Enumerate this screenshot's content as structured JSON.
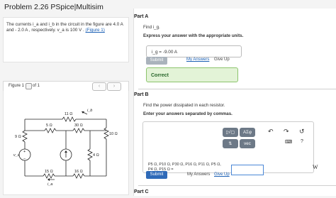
{
  "app": {
    "title": "Problem 2.26 PSpice|Multisim"
  },
  "problem": {
    "text": "The currents i_a and i_b in the circuit in the figure are 4.0 A and - 2.0 A , respectively. v_a is 100 V .",
    "figure_link": "(Figure 1)"
  },
  "figure": {
    "label": "Figure 1",
    "index": "1",
    "of_label": "of 1",
    "prev_icon": "chevron-left-icon",
    "next_icon": "chevron-right-icon",
    "circuit": {
      "r_top": "11 Ω",
      "r_9": "9 Ω",
      "r_5": "5 Ω",
      "r_30": "30 Ω",
      "r_10": "10 Ω",
      "r_4": "4 Ω",
      "r_15": "15 Ω",
      "r_16": "16 Ω",
      "i_b": "i_b",
      "i_a": "i_a",
      "v_a": "v_a",
      "src_plus": "+",
      "src_minus": "−"
    }
  },
  "partA": {
    "title": "Part A",
    "question": "Find i_g.",
    "instruction": "Express your answer with the appropriate units.",
    "answer": "i_g =  -9.00 A",
    "submit_label": "Submit",
    "my_answers_label": "My Answers",
    "give_up_label": "Give Up",
    "feedback": "Correct"
  },
  "partB": {
    "title": "Part B",
    "question": "Find the power dissipated in each resistor.",
    "instruction": "Enter your answers separated by commas.",
    "toolbar": {
      "templates_icon": "templates-icon",
      "symbols_label": "ΑΣφ",
      "arrows_icon": "arrows-icon",
      "vec_label": "vec",
      "undo_icon": "undo-icon",
      "redo_icon": "redo-icon",
      "reset_icon": "reset-icon",
      "keyboard_icon": "keyboard-icon",
      "help_icon": "help-icon"
    },
    "answer_prompt": "P5 Ω, P10 Ω, P30 Ω, P16 Ω, P11 Ω, P5 Ω, P4 Ω, P15 Ω =",
    "unit": "W",
    "submit_label": "Submit",
    "my_answers_label": "My Answers",
    "give_up_label": "Give Up"
  },
  "partC": {
    "title": "Part C"
  },
  "colors": {
    "accent": "#2f6ab8",
    "success_bg": "#e3f3d7",
    "success_border": "#8cc46c",
    "toolbar": "#6d7987"
  }
}
